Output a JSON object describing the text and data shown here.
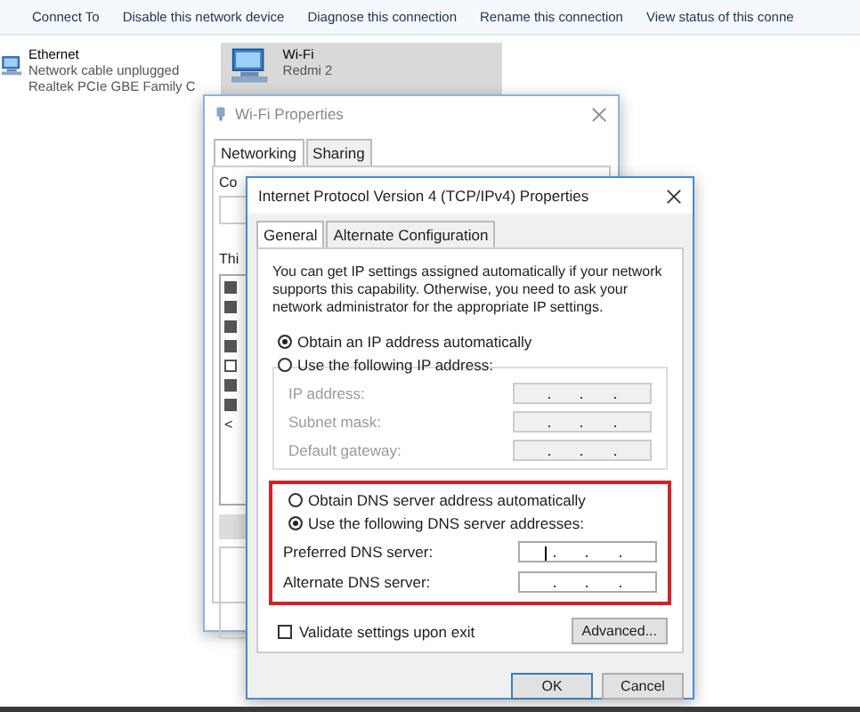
{
  "toolbar": {
    "items": [
      "Connect To",
      "Disable this network device",
      "Diagnose this connection",
      "Rename this connection",
      "View status of this conne"
    ]
  },
  "connections": [
    {
      "name": "Ethernet",
      "status": "Network cable unplugged",
      "adapter": "Realtek PCIe GBE Family C",
      "selected": false
    },
    {
      "name": "Wi-Fi",
      "status": "Redmi 2",
      "selected": true
    }
  ],
  "wifi_properties": {
    "title": "Wi-Fi Properties",
    "tabs": [
      {
        "label": "Networking",
        "selected": true
      },
      {
        "label": "Sharing",
        "selected": false
      }
    ],
    "connect_using_label": "Co",
    "items_label": "Thi",
    "components": [
      {
        "checked": true
      },
      {
        "checked": true
      },
      {
        "checked": true
      },
      {
        "checked": true
      },
      {
        "checked": false
      },
      {
        "checked": true
      },
      {
        "checked": true
      }
    ],
    "scroll_arrow": "<"
  },
  "ipv4_properties": {
    "title": "Internet Protocol Version 4 (TCP/IPv4) Properties",
    "tabs": [
      {
        "label": "General",
        "selected": true
      },
      {
        "label": "Alternate Configuration",
        "selected": false
      }
    ],
    "description": "You can get IP settings assigned automatically if your network supports this capability. Otherwise, you need to ask your network administrator for the appropriate IP settings.",
    "ip_options": [
      {
        "label": "Obtain an IP address automatically",
        "selected": true
      },
      {
        "label": "Use the following IP address:",
        "selected": false
      }
    ],
    "ip_fields": [
      {
        "label": "IP address:",
        "disabled": true
      },
      {
        "label": "Subnet mask:",
        "disabled": true
      },
      {
        "label": "Default gateway:",
        "disabled": true
      }
    ],
    "dns_options": [
      {
        "label": "Obtain DNS server address automatically",
        "selected": false
      },
      {
        "label": "Use the following DNS server addresses:",
        "selected": true
      }
    ],
    "dns_fields": [
      {
        "label": "Preferred DNS server:",
        "disabled": false
      },
      {
        "label": "Alternate DNS server:",
        "disabled": false
      }
    ],
    "validate": {
      "label": "Validate settings upon exit",
      "checked": false
    },
    "buttons": {
      "advanced": "Advanced...",
      "ok": "OK",
      "cancel": "Cancel"
    }
  }
}
